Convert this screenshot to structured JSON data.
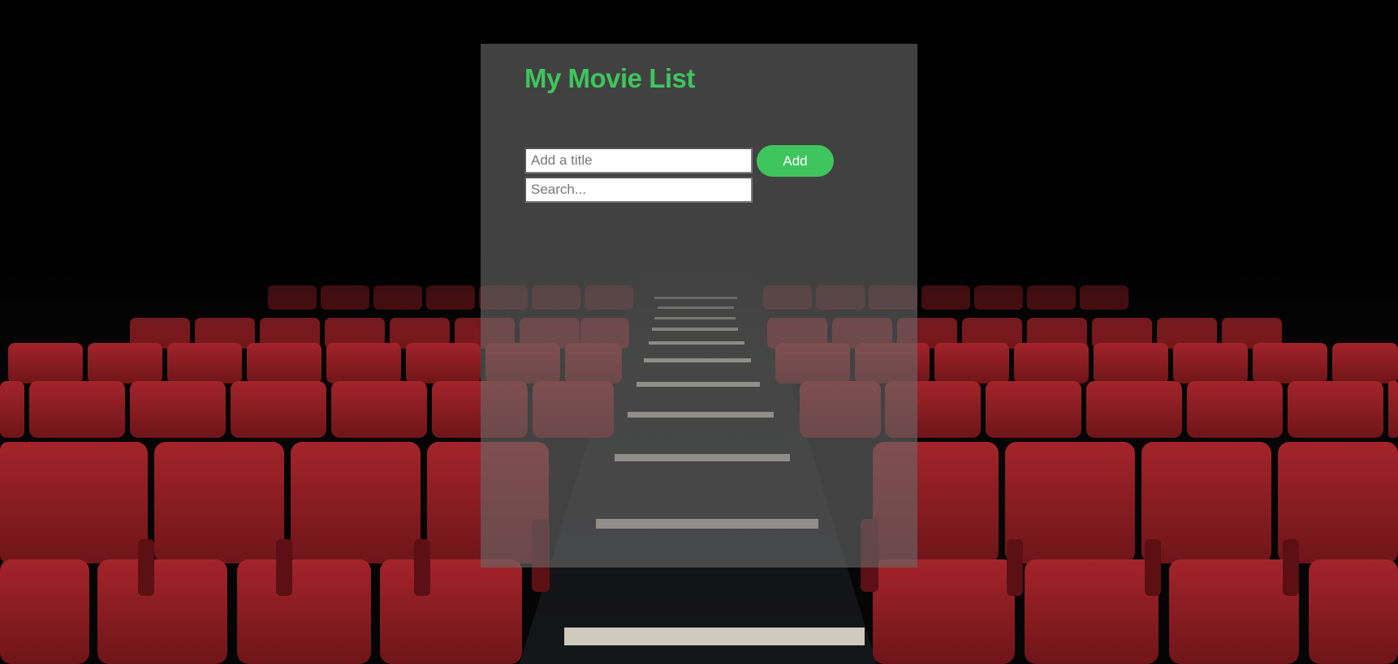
{
  "app": {
    "title": "My Movie List"
  },
  "form": {
    "title_placeholder": "Add a title",
    "title_value": "",
    "add_label": "Add",
    "search_placeholder": "Search...",
    "search_value": ""
  },
  "background": {
    "subject": "cinema-seats-photo"
  },
  "colors": {
    "accent": "#3fc55d",
    "panel": "#4a4a4a",
    "seat_red": "#8e1d22"
  }
}
